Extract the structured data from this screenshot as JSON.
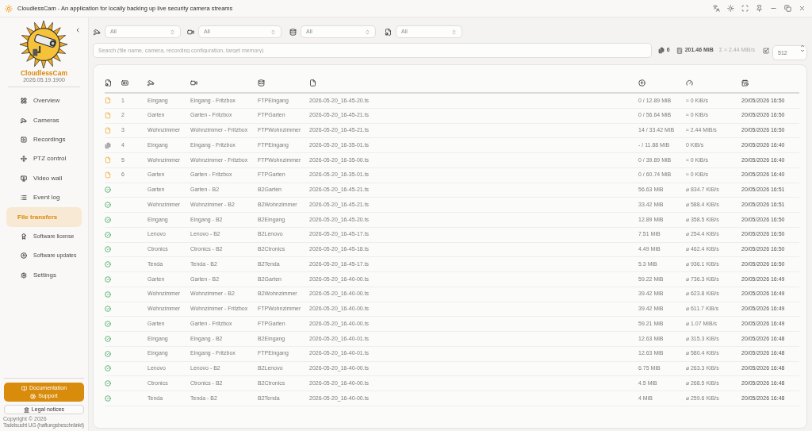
{
  "window": {
    "title": "CloudlessCam - An application for locally backing up live security camera streams"
  },
  "sidebar": {
    "app_name": "CloudlessCam",
    "version": "2026.05.19.1900",
    "items": [
      {
        "label": "Overview",
        "selected": false
      },
      {
        "label": "Cameras",
        "selected": false
      },
      {
        "label": "Recordings",
        "selected": false
      },
      {
        "label": "PTZ control",
        "selected": false
      },
      {
        "label": "Video wall",
        "selected": false
      },
      {
        "label": "Event log",
        "selected": false
      },
      {
        "label": "File transfers",
        "selected": true
      },
      {
        "label": "Software license",
        "selected": false
      },
      {
        "label": "Software updates",
        "selected": false
      },
      {
        "label": "Settings",
        "selected": false
      }
    ],
    "documentation": "Documentation",
    "support": "Support",
    "legal_notices": "Legal notices",
    "copyright": "Copyright © 2026",
    "company": "Tadelsucht UG (haftungsbeschränkt)"
  },
  "filters": [
    {
      "value": "All"
    },
    {
      "value": "All"
    },
    {
      "value": "All"
    },
    {
      "value": "All"
    }
  ],
  "search": {
    "placeholder": "Search (file name, camera, recording configuration, target memory)"
  },
  "stats": {
    "files": "6",
    "size": "201.46 MiB",
    "rate": "Σ ≈ 2.44 MiB/s",
    "limit": "512"
  },
  "table": {
    "rows": [
      {
        "kind": "queued",
        "index": "1",
        "camera": "Eingang",
        "configuration": "Eingang - Fritzbox",
        "memory": "FTPEingang",
        "file": "2026-05-20_16-45-20.ts",
        "size": "0 / 12.89 MiB",
        "speed": "≈ 0 KiB/s",
        "date": "20/05/2026 16:50"
      },
      {
        "kind": "queued",
        "index": "2",
        "camera": "Garten",
        "configuration": "Garten - Fritzbox",
        "memory": "FTPGarten",
        "file": "2026-05-20_16-45-21.ts",
        "size": "0 / 56.64 MiB",
        "speed": "≈ 0 KiB/s",
        "date": "20/05/2026 16:50"
      },
      {
        "kind": "queued",
        "index": "3",
        "camera": "Wohnzimmer",
        "configuration": "Wohnzimmer - Fritzbox",
        "memory": "FTPWohnzimmer",
        "file": "2026-05-20_16-45-21.ts",
        "size": "14 / 33.42 MiB",
        "speed": "≈ 2.44 MiB/s",
        "date": "20/05/2026 16:50"
      },
      {
        "kind": "inactive",
        "index": "4",
        "camera": "Eingang",
        "configuration": "Eingang - Fritzbox",
        "memory": "FTPEingang",
        "file": "2026-05-20_16-35-01.ts",
        "size": "- / 11.88 MiB",
        "speed": "0 KiB/s",
        "date": "20/05/2026 16:40"
      },
      {
        "kind": "queued",
        "index": "5",
        "camera": "Wohnzimmer",
        "configuration": "Wohnzimmer - Fritzbox",
        "memory": "FTPWohnzimmer",
        "file": "2026-05-20_16-35-00.ts",
        "size": "0 / 39.89 MiB",
        "speed": "≈ 0 KiB/s",
        "date": "20/05/2026 16:40"
      },
      {
        "kind": "queued",
        "index": "6",
        "camera": "Garten",
        "configuration": "Garten - Fritzbox",
        "memory": "FTPGarten",
        "file": "2026-05-20_16-35-01.ts",
        "size": "0 / 60.74 MiB",
        "speed": "≈ 0 KiB/s",
        "date": "20/05/2026 16:40"
      },
      {
        "kind": "done",
        "camera": "Garten",
        "configuration": "Garten - B2",
        "memory": "B2Garten",
        "file": "2026-05-20_16-45-21.ts",
        "size": "56.63 MiB",
        "speed": "⌀ 834.7 KiB/s",
        "date": "20/05/2026 16:51"
      },
      {
        "kind": "done",
        "camera": "Wohnzimmer",
        "configuration": "Wohnzimmer - B2",
        "memory": "B2Wohnzimmer",
        "file": "2026-05-20_16-45-21.ts",
        "size": "33.42 MiB",
        "speed": "⌀ 588.4 KiB/s",
        "date": "20/05/2026 16:51"
      },
      {
        "kind": "done",
        "camera": "Eingang",
        "configuration": "Eingang - B2",
        "memory": "B2Eingang",
        "file": "2026-05-20_16-45-20.ts",
        "size": "12.89 MiB",
        "speed": "⌀ 358.5 KiB/s",
        "date": "20/05/2026 16:50"
      },
      {
        "kind": "done",
        "camera": "Lenovo",
        "configuration": "Lenovo - B2",
        "memory": "B2Lenovo",
        "file": "2026-05-20_16-45-17.ts",
        "size": "7.51 MiB",
        "speed": "⌀ 254.4 KiB/s",
        "date": "20/05/2026 16:50"
      },
      {
        "kind": "done",
        "camera": "Ctronics",
        "configuration": "Ctronics - B2",
        "memory": "B2Ctronics",
        "file": "2026-05-20_16-45-18.ts",
        "size": "4.49 MiB",
        "speed": "⌀ 462.4 KiB/s",
        "date": "20/05/2026 16:50"
      },
      {
        "kind": "done",
        "camera": "Tenda",
        "configuration": "Tenda - B2",
        "memory": "B2Tenda",
        "file": "2026-05-20_16-45-17.ts",
        "size": "5.3 MiB",
        "speed": "⌀ 936.1 KiB/s",
        "date": "20/05/2026 16:50"
      },
      {
        "kind": "done",
        "camera": "Garten",
        "configuration": "Garten - B2",
        "memory": "B2Garten",
        "file": "2026-05-20_16-40-00.ts",
        "size": "59.22 MiB",
        "speed": "⌀ 736.3 KiB/s",
        "date": "20/05/2026 16:49"
      },
      {
        "kind": "done",
        "camera": "Wohnzimmer",
        "configuration": "Wohnzimmer - B2",
        "memory": "B2Wohnzimmer",
        "file": "2026-05-20_16-40-00.ts",
        "size": "39.42 MiB",
        "speed": "⌀ 623.8 KiB/s",
        "date": "20/05/2026 16:49"
      },
      {
        "kind": "done",
        "camera": "Wohnzimmer",
        "configuration": "Wohnzimmer - Fritzbox",
        "memory": "FTPWohnzimmer",
        "file": "2026-05-20_16-40-00.ts",
        "size": "39.42 MiB",
        "speed": "⌀ 611.7 KiB/s",
        "date": "20/05/2026 16:49"
      },
      {
        "kind": "done",
        "camera": "Garten",
        "configuration": "Garten - Fritzbox",
        "memory": "FTPGarten",
        "file": "2026-05-20_16-40-00.ts",
        "size": "59.21 MiB",
        "speed": "⌀ 1.07 MiB/s",
        "date": "20/05/2026 16:49"
      },
      {
        "kind": "done",
        "camera": "Eingang",
        "configuration": "Eingang - B2",
        "memory": "B2Eingang",
        "file": "2026-05-20_16-40-01.ts",
        "size": "12.63 MiB",
        "speed": "⌀ 315.3 KiB/s",
        "date": "20/05/2026 16:48"
      },
      {
        "kind": "done",
        "camera": "Eingang",
        "configuration": "Eingang - Fritzbox",
        "memory": "FTPEingang",
        "file": "2026-05-20_16-40-01.ts",
        "size": "12.63 MiB",
        "speed": "⌀ 580.4 KiB/s",
        "date": "20/05/2026 16:48"
      },
      {
        "kind": "done",
        "camera": "Lenovo",
        "configuration": "Lenovo - B2",
        "memory": "B2Lenovo",
        "file": "2026-05-20_16-40-00.ts",
        "size": "6.75 MiB",
        "speed": "⌀ 263.3 KiB/s",
        "date": "20/05/2026 16:48"
      },
      {
        "kind": "done",
        "camera": "Ctronics",
        "configuration": "Ctronics - B2",
        "memory": "B2Ctronics",
        "file": "2026-05-20_16-40-00.ts",
        "size": "4.5 MiB",
        "speed": "⌀ 268.5 KiB/s",
        "date": "20/05/2026 16:48"
      },
      {
        "kind": "done",
        "camera": "Tenda",
        "configuration": "Tenda - B2",
        "memory": "B2Tenda",
        "file": "2026-05-20_16-40-00.ts",
        "size": "4 MiB",
        "speed": "⌀ 259.6 KiB/s",
        "date": "20/05/2026 16:48"
      }
    ]
  }
}
